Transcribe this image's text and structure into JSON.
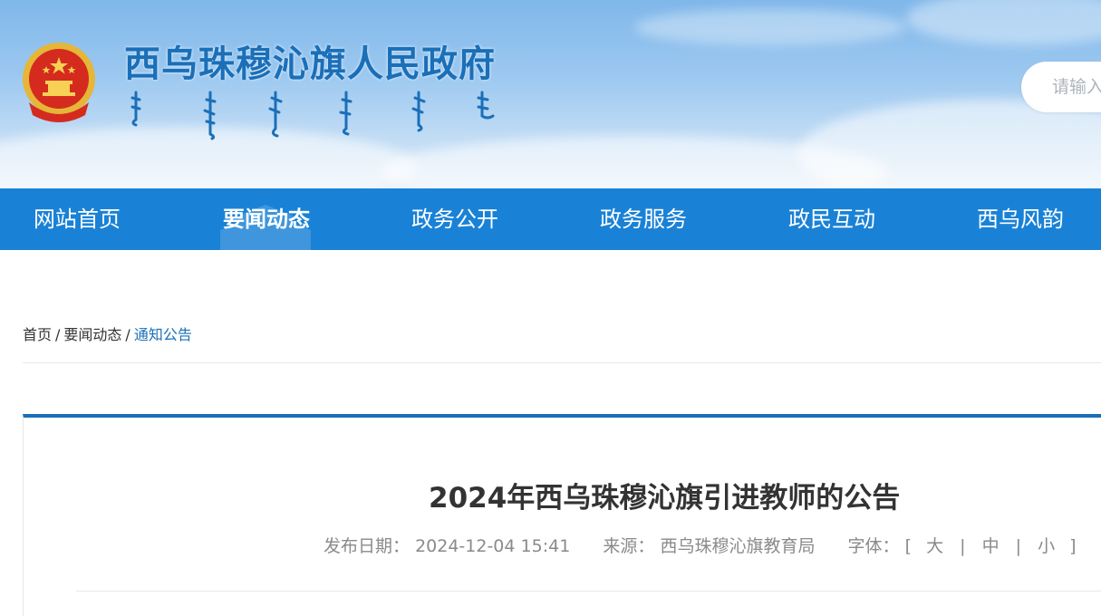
{
  "header": {
    "site_title": "西乌珠穆沁旗人民政府",
    "emblem_icon": "national-emblem-icon",
    "search": {
      "placeholder": "请输入"
    }
  },
  "nav": {
    "items": [
      {
        "label": "网站首页",
        "active": false
      },
      {
        "label": "要闻动态",
        "active": true
      },
      {
        "label": "政务公开",
        "active": false
      },
      {
        "label": "政务服务",
        "active": false
      },
      {
        "label": "政民互动",
        "active": false
      },
      {
        "label": "西乌风韵",
        "active": false
      }
    ]
  },
  "breadcrumb": {
    "items": [
      "首页",
      "要闻动态",
      "通知公告"
    ],
    "separator": "/"
  },
  "article": {
    "title": "2024年西乌珠穆沁旗引进教师的公告",
    "meta": {
      "date_label": "发布日期：",
      "date": "2024-12-04 15:41",
      "source_label": "来源：",
      "source": "西乌珠穆沁旗教育局",
      "font_label": "字体：",
      "bracket_open": "[",
      "bracket_close": "]",
      "divider": "|",
      "font_large": "大",
      "font_medium": "中",
      "font_small": "小"
    }
  },
  "colors": {
    "nav_bg": "#1a82d6",
    "title_blue": "#1a6fb8",
    "accent_border": "#1a6fb8"
  }
}
